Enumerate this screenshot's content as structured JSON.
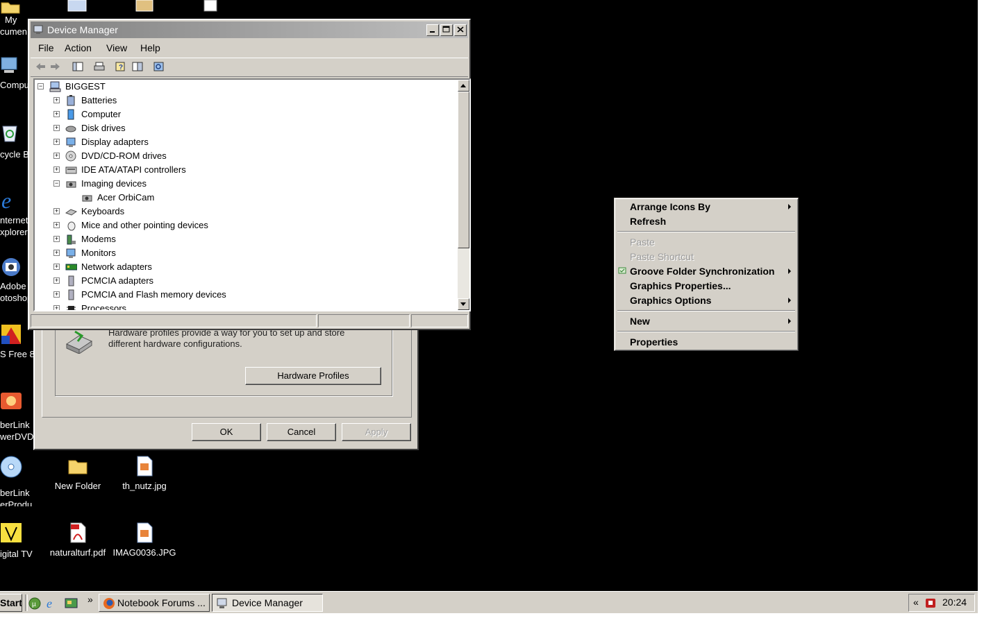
{
  "desktop": {
    "left_column": [
      "My",
      "cumen",
      "Compu",
      "cycle B",
      "nternet",
      "xplorer",
      "Adobe",
      "otoshop",
      "S Free 8.",
      "berLink",
      "werDVD",
      "berLink",
      "erProdu...",
      "igital TV"
    ],
    "icons": [
      {
        "label": "New Folder"
      },
      {
        "label": "th_nutz.jpg"
      },
      {
        "label": "naturalturf.pdf"
      },
      {
        "label": "IMAG0036.JPG"
      }
    ]
  },
  "system_properties": {
    "description": "Hardware profiles provide a way for you to set up and store different hardware configurations.",
    "hardware_profiles_button": "Hardware Profiles",
    "ok_button": "OK",
    "cancel_button": "Cancel",
    "apply_button": "Apply"
  },
  "device_manager": {
    "title": "Device Manager",
    "menu": {
      "file": "File",
      "action": "Action",
      "view": "View",
      "help": "Help"
    },
    "tree_root": "BIGGEST",
    "tree": [
      {
        "label": "Batteries",
        "icon": "battery-icon",
        "expanded": false
      },
      {
        "label": "Computer",
        "icon": "computer-icon",
        "expanded": false
      },
      {
        "label": "Disk drives",
        "icon": "disk-drive-icon",
        "expanded": false
      },
      {
        "label": "Display adapters",
        "icon": "display-adapter-icon",
        "expanded": false
      },
      {
        "label": "DVD/CD-ROM drives",
        "icon": "dvd-drive-icon",
        "expanded": false
      },
      {
        "label": "IDE ATA/ATAPI controllers",
        "icon": "ide-controller-icon",
        "expanded": false
      },
      {
        "label": "Imaging devices",
        "icon": "camera-icon",
        "expanded": true
      },
      {
        "label": "Acer OrbiCam",
        "icon": "camera-icon",
        "child": true
      },
      {
        "label": "Keyboards",
        "icon": "keyboard-icon",
        "expanded": false
      },
      {
        "label": "Mice and other pointing devices",
        "icon": "mouse-icon",
        "expanded": false
      },
      {
        "label": "Modems",
        "icon": "modem-icon",
        "expanded": false
      },
      {
        "label": "Monitors",
        "icon": "monitor-icon",
        "expanded": false
      },
      {
        "label": "Network adapters",
        "icon": "network-adapter-icon",
        "expanded": false
      },
      {
        "label": "PCMCIA adapters",
        "icon": "pcmcia-icon",
        "expanded": false
      },
      {
        "label": "PCMCIA and Flash memory devices",
        "icon": "pcmcia-icon",
        "expanded": false
      },
      {
        "label": "Processors",
        "icon": "processor-icon",
        "expanded": false
      }
    ]
  },
  "context_menu": {
    "arrange_icons_by": "Arrange Icons By",
    "refresh": "Refresh",
    "paste": "Paste",
    "paste_shortcut": "Paste Shortcut",
    "groove": "Groove Folder Synchronization",
    "graphics_properties": "Graphics Properties...",
    "graphics_options": "Graphics Options",
    "new": "New",
    "properties": "Properties"
  },
  "taskbar": {
    "start": "Start",
    "chevron": "»",
    "tasks": [
      "Notebook Forums ...",
      "Device Manager"
    ],
    "tray_chevron": "«",
    "clock": "20:24"
  },
  "colors": {
    "desktop": "#000000",
    "face": "#d4d0c8",
    "title_inactive": "#808080"
  }
}
